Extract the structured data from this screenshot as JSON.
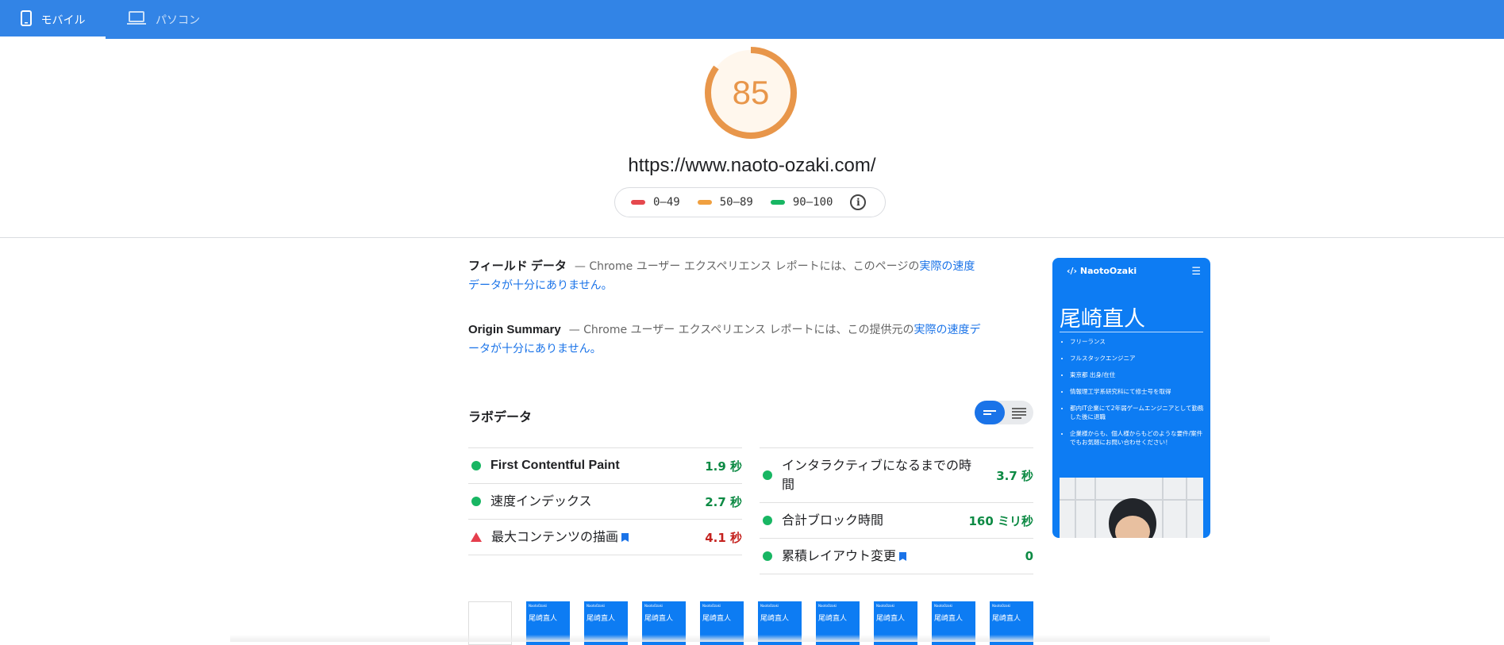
{
  "tabs": [
    {
      "label": "モバイル",
      "icon": "smartphone-icon",
      "active": true
    },
    {
      "label": "パソコン",
      "icon": "laptop-icon",
      "active": false
    }
  ],
  "score": {
    "value": "85",
    "fraction": 0.85,
    "color": "#e8964a"
  },
  "url": "https://www.naoto-ozaki.com/",
  "legend": {
    "ranges": [
      {
        "label": "0–49",
        "color": "#e5484d"
      },
      {
        "label": "50–89",
        "color": "#f0a040"
      },
      {
        "label": "90–100",
        "color": "#18b663"
      }
    ],
    "info_icon": "info-icon"
  },
  "field": {
    "title": "フィールド データ",
    "text": "— Chrome ユーザー エクスペリエンス レポートには、このページの",
    "link": "実際の速度データが十分にありません。"
  },
  "origin": {
    "title": "Origin Summary",
    "text": "— Chrome ユーザー エクスペリエンス レポートには、この提供元の",
    "link": "実際の速度データが十分にありません。"
  },
  "lab": {
    "title": "ラボデータ"
  },
  "metrics_left": [
    {
      "name": "First Contentful Paint",
      "value": "1.9 秒",
      "status": "good"
    },
    {
      "name": "速度インデックス",
      "value": "2.7 秒",
      "status": "good"
    },
    {
      "name": "最大コンテンツの描画",
      "value": "4.1 秒",
      "status": "bad"
    }
  ],
  "metrics_right": [
    {
      "name": "インタラクティブになるまでの時間",
      "value": "3.7 秒",
      "status": "good"
    },
    {
      "name": "合計ブロック時間",
      "value": "160 ミリ秒",
      "status": "good"
    },
    {
      "name": "累積レイアウト変更",
      "value": "0",
      "status": "good"
    }
  ],
  "screenshot": {
    "logo": "‹/› NaotoOzaki",
    "title": "尾崎直人",
    "items": [
      "フリーランス",
      "フルスタックエンジニア",
      "東京都 出身/在住",
      "情報理工学系研究科にて修士号を取得",
      "都内IT企業にて2年弱ゲームエンジニアとして勤務した後に退職",
      "企業様からも、個人様からもどのような要件/案件でもお気軽にお問い合わせください！"
    ]
  },
  "filmstrip": {
    "frame_title": "尾崎直人",
    "frame_logo": "NaotoOzaki"
  }
}
